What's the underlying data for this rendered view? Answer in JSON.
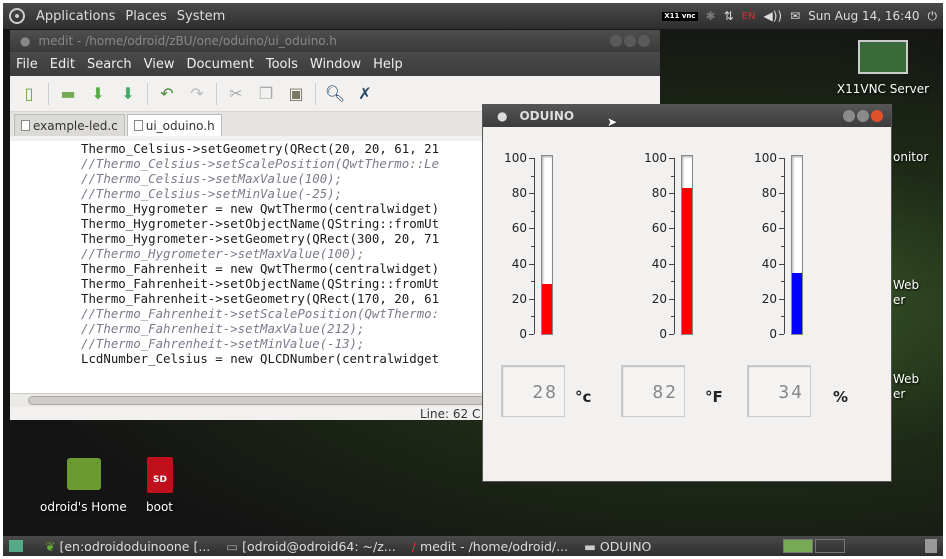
{
  "top_panel": {
    "menus": [
      "Applications",
      "Places",
      "System"
    ],
    "vnc_label": "X11 vnc",
    "keyboard": "EN",
    "clock": "Sun Aug 14, 16:40"
  },
  "medit": {
    "title": "medit - /home/odroid/zBU/one/oduino/ui_oduino.h",
    "menu": [
      "File",
      "Edit",
      "Search",
      "View",
      "Document",
      "Tools",
      "Window",
      "Help"
    ],
    "tabs": [
      "example-led.c",
      "ui_oduino.h"
    ],
    "code_lines": [
      {
        "text": "Thermo_Celsius->setGeometry(QRect(20, 20, 61, 21",
        "comment": false
      },
      {
        "text": "//Thermo_Celsius->setScalePosition(QwtThermo::Le",
        "comment": true
      },
      {
        "text": "//Thermo_Celsius->setMaxValue(100);",
        "comment": true
      },
      {
        "text": "//Thermo_Celsius->setMinValue(-25);",
        "comment": true
      },
      {
        "text": "Thermo_Hygrometer = new QwtThermo(centralwidget)",
        "comment": false
      },
      {
        "text": "Thermo_Hygrometer->setObjectName(QString::fromUt",
        "comment": false
      },
      {
        "text": "Thermo_Hygrometer->setGeometry(QRect(300, 20, 71",
        "comment": false
      },
      {
        "text": "//Thermo_Hygrometer->setMaxValue(100);",
        "comment": true
      },
      {
        "text": "Thermo_Fahrenheit = new QwtThermo(centralwidget)",
        "comment": false
      },
      {
        "text": "Thermo_Fahrenheit->setObjectName(QString::fromUt",
        "comment": false
      },
      {
        "text": "Thermo_Fahrenheit->setGeometry(QRect(170, 20, 61",
        "comment": false
      },
      {
        "text": "//Thermo_Fahrenheit->setScalePosition(QwtThermo:",
        "comment": true
      },
      {
        "text": "//Thermo_Fahrenheit->setMaxValue(212);",
        "comment": true
      },
      {
        "text": "//Thermo_Fahrenheit->setMinValue(-13);",
        "comment": true
      },
      {
        "text": "LcdNumber_Celsius = new QLCDNumber(centralwidget",
        "comment": false
      }
    ],
    "status": "Line: 62 C"
  },
  "desktop_icons": {
    "vnc_server": "X11VNC Server",
    "monitor_partial": "onitor",
    "web1_partial_a": "Web",
    "web1_partial_b": "er",
    "web2_partial_a": "Web",
    "web2_partial_b": "er",
    "home": "odroid's Home",
    "boot": "boot",
    "sd_label": "SD"
  },
  "oduino": {
    "title": "ODUINO",
    "scale_labels": [
      "100",
      "80",
      "60",
      "40",
      "20",
      "0"
    ],
    "thermometers": [
      {
        "name": "celsius",
        "value": 28,
        "max": 100,
        "color": "#ff0000",
        "display": "28",
        "unit": "°c"
      },
      {
        "name": "fahrenheit",
        "value": 82,
        "max": 100,
        "color": "#ff0000",
        "display": "82",
        "unit": "°F"
      },
      {
        "name": "humidity",
        "value": 34,
        "max": 100,
        "color": "#0000ff",
        "display": "34",
        "unit": "%"
      }
    ]
  },
  "taskbar": {
    "tasks": [
      "[en:odroidoduinoone [...",
      "[odroid@odroid64: ~/z...",
      "medit - /home/odroid/...",
      "ODUINO"
    ]
  }
}
